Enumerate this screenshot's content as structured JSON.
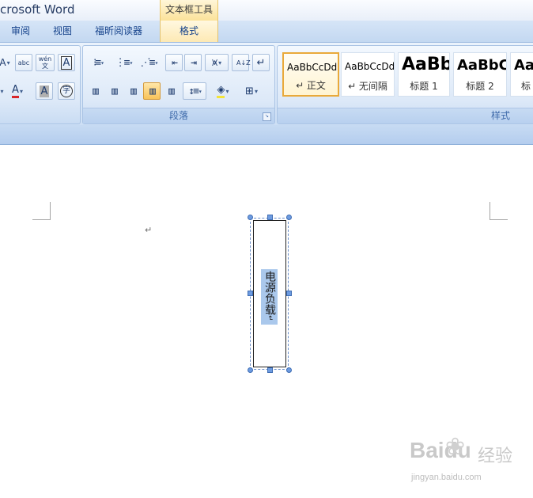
{
  "window": {
    "title": "crosoft Word"
  },
  "context_tab_group": {
    "label": "文本框工具"
  },
  "tabs": [
    {
      "label": "审阅"
    },
    {
      "label": "视图"
    },
    {
      "label": "福昕阅读器"
    },
    {
      "label": "格式",
      "active": true
    }
  ],
  "ribbon": {
    "font_group": {
      "row1": [
        "A",
        "abc",
        "wén 文",
        "A"
      ],
      "row2": [
        "A",
        "A",
        "字"
      ]
    },
    "paragraph_group": {
      "label": "段落",
      "row1_icons": [
        "bullet-list-icon",
        "numbered-list-icon",
        "multilevel-list-icon",
        "decrease-indent-icon",
        "increase-indent-icon",
        "chinese-layout-icon",
        "sort-icon",
        "show-marks-icon"
      ],
      "row2_icons": [
        "align-left-icon",
        "align-center-icon",
        "align-right-icon",
        "justify-icon",
        "distributed-icon",
        "line-spacing-icon",
        "shading-icon",
        "borders-icon"
      ],
      "sort_label": "A↓Z",
      "show_marks_label": "↵"
    },
    "styles_group": {
      "label": "样式",
      "items": [
        {
          "sample": "AaBbCcDd",
          "name": "↵ 正文",
          "selected": true
        },
        {
          "sample": "AaBbCcDd",
          "name": "↵ 无间隔"
        },
        {
          "sample": "AaBb",
          "name": "标题 1"
        },
        {
          "sample": "AaBbC",
          "name": "标题 2"
        },
        {
          "sample": "Aa",
          "name": "标"
        }
      ]
    }
  },
  "document": {
    "paragraph_mark": "↵",
    "textbox": {
      "text": "电源负载",
      "end_mark": "↵"
    }
  },
  "watermark": {
    "logo": "Baidu",
    "brand": "经验",
    "url": "jingyan.baidu.com"
  },
  "colors": {
    "ribbon_bg": "#dbe8f8",
    "context_tab": "#fbe29a",
    "selection": "#aac8ec",
    "handle": "#6d9be0"
  }
}
